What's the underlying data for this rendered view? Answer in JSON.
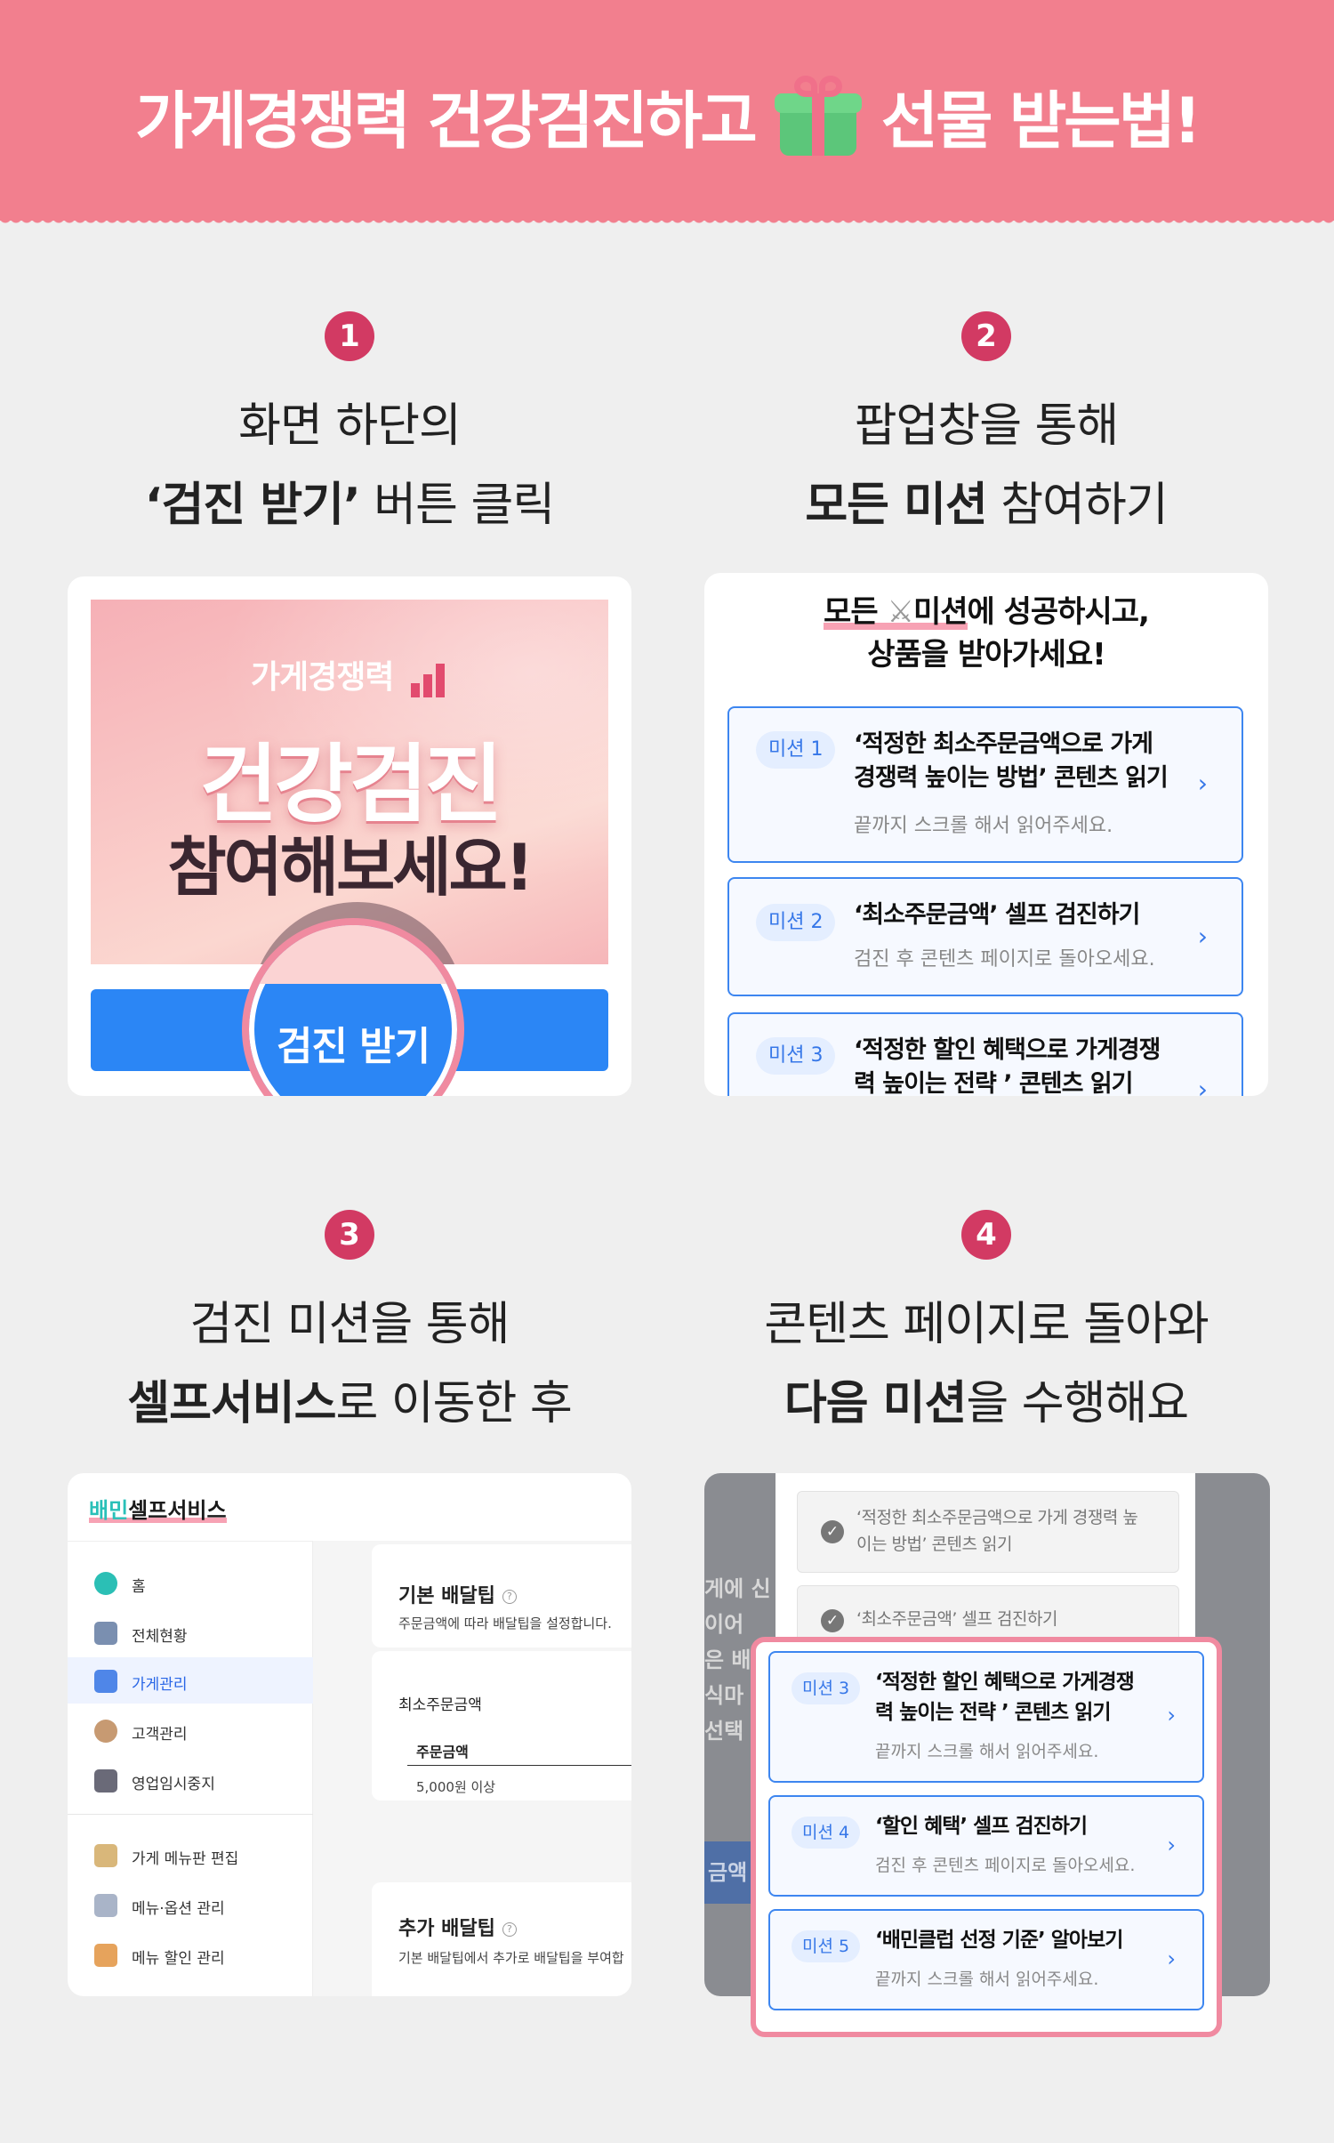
{
  "header": {
    "title_left": "가게경쟁력 건강검진하고",
    "title_right": "선물 받는법!"
  },
  "steps": [
    {
      "number": "1",
      "line1": "화면 하단의",
      "line2_bold": "‘검진 받기’",
      "line2_rest": " 버튼 클릭"
    },
    {
      "number": "2",
      "line1": "팝업창을 통해",
      "line2_bold": "모든 미션",
      "line2_rest": " 참여하기"
    },
    {
      "number": "3",
      "line1": "검진 미션을 통해",
      "line2_bold": "셀프서비스",
      "line2_rest": "로 이동한 후"
    },
    {
      "number": "4",
      "line1": "콘텐츠 페이지로 돌아와",
      "line2_bold": "다음 미션",
      "line2_rest": "을 수행해요"
    }
  ],
  "card1": {
    "banner_small": "가게경쟁력",
    "banner_big": "건강검진",
    "banner_mid": "참여해보세요!",
    "button_label": "검진 받기"
  },
  "card2": {
    "head_prefix": "모든",
    "head_underlined": "미션",
    "head_line1_rest": "에 성공하시고,",
    "head_line2": "상품을 받아가세요!",
    "missions": [
      {
        "badge": "미션 1",
        "title1": "‘적정한 최소주문금액으로 가게",
        "title2": "경쟁력 높이는 방법’ 콘텐츠 읽기",
        "sub": "끝까지 스크롤 해서 읽어주세요."
      },
      {
        "badge": "미션 2",
        "title1": "‘최소주문금액’ 셀프 검진하기",
        "sub": "검진 후 콘텐츠 페이지로 돌아오세요."
      },
      {
        "badge": "미션 3",
        "title1": "‘적정한 할인 혜택으로 가게경쟁",
        "title2": "력 높이는 전략 ’ 콘텐츠 읽기"
      }
    ]
  },
  "card3": {
    "brand_a": "배민",
    "brand_b": "셀프서비스",
    "menu": [
      {
        "label": "홈",
        "icon": "home-icon",
        "color": "#2bbfb5"
      },
      {
        "label": "전체현황",
        "icon": "dashboard-icon",
        "color": "#7a8fb0"
      },
      {
        "label": "가게관리",
        "icon": "store-icon",
        "color": "#4f86e8",
        "active": true
      },
      {
        "label": "고객관리",
        "icon": "customer-icon",
        "color": "#c79a72"
      },
      {
        "label": "영업임시중지",
        "icon": "pause-store-icon",
        "color": "#6a6a78"
      },
      {
        "label": "가게 메뉴판 편집",
        "icon": "menu-board-icon",
        "color": "#d9b77a"
      },
      {
        "label": "메뉴·옵션 관리",
        "icon": "menu-option-icon",
        "color": "#a9b4c8"
      },
      {
        "label": "메뉴 할인 관리",
        "icon": "menu-discount-icon",
        "color": "#e6a35c"
      }
    ],
    "panel1": {
      "title": "기본 배달팁",
      "help": "?",
      "sub": "주문금액에 따라 배달팁을 설정합니다."
    },
    "panel2": {
      "label": "최소주문금액",
      "column": "주문금액",
      "value": "5,000원 이상"
    },
    "panel3": {
      "title": "추가 배달팁",
      "help": "?",
      "sub": "기본 배달팁에서 추가로 배달팁을 부여합"
    }
  },
  "card4": {
    "done": [
      {
        "line1": "‘적정한 최소주문금액으로 가게 경쟁력 높",
        "line2": "이는 방법’ 콘텐츠 읽기"
      },
      {
        "line1": "‘최소주문금액’ 셀프 검진하기"
      }
    ],
    "ghost_text": [
      "게에 신",
      "이어",
      "은 배달",
      "식마",
      "선택"
    ],
    "ghost_button": "금액 ",
    "missions": [
      {
        "badge": "미션 3",
        "title1": "‘적정한 할인 혜택으로 가게경쟁",
        "title2": "력 높이는 전략 ’ 콘텐츠 읽기",
        "sub": "끝까지 스크롤 해서 읽어주세요."
      },
      {
        "badge": "미션 4",
        "title1": "‘할인 혜택’ 셀프 검진하기",
        "sub": "검진 후 콘텐츠 페이지로 돌아오세요."
      },
      {
        "badge": "미션 5",
        "title1": "‘배민클럽 선정 기준’ 알아보기",
        "sub": "끝까지 스크롤 해서 읽어주세요."
      }
    ]
  },
  "colors": {
    "header_bg": "#f27f8e",
    "accent_pink": "#d23a63",
    "button_blue": "#2b86f5",
    "mission_blue": "#3d86f0"
  }
}
